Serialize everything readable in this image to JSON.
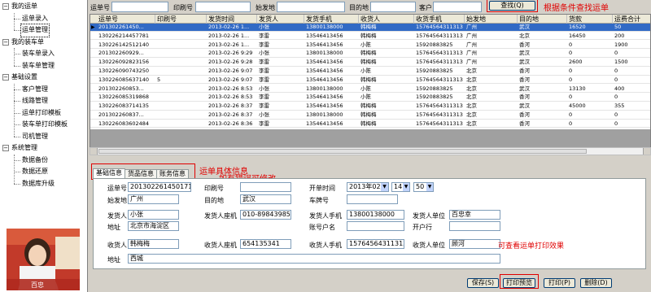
{
  "sidebar": {
    "items": [
      {
        "label": "我的运单",
        "level": 0
      },
      {
        "label": "运单录入",
        "level": 1
      },
      {
        "label": "运单管理",
        "level": 1,
        "selected": true
      },
      {
        "label": "我的装车单",
        "level": 0
      },
      {
        "label": "装车单录入",
        "level": 1
      },
      {
        "label": "装车单管理",
        "level": 1
      },
      {
        "label": "基础设置",
        "level": 0
      },
      {
        "label": "客户管理",
        "level": 1
      },
      {
        "label": "线路管理",
        "level": 1
      },
      {
        "label": "运单打印模板",
        "level": 1
      },
      {
        "label": "装车单打印模板",
        "level": 1
      },
      {
        "label": "司机管理",
        "level": 1
      },
      {
        "label": "系统管理",
        "level": 0
      },
      {
        "label": "数据备份",
        "level": 1
      },
      {
        "label": "数据还原",
        "level": 1
      },
      {
        "label": "数据库升级",
        "level": 1
      }
    ],
    "portrait_caption": "百忠"
  },
  "search": {
    "labels": [
      "运单号",
      "印刷号",
      "始发地",
      "目的地",
      "客户"
    ],
    "button": "查找(Q)",
    "annotation": "根据条件查找运单"
  },
  "grid": {
    "columns": [
      "运单号",
      "印刷号",
      "发货时间",
      "发货人",
      "发货手机",
      "收货人",
      "收货手机",
      "始发地",
      "目的地",
      "货款",
      "运费合计"
    ],
    "rows": [
      [
        "201302261450...",
        "",
        "2013-02-26 1...",
        "小张",
        "13800138000",
        "韩梅梅",
        "15764564311313",
        "广州",
        "武汉",
        "16520",
        "50"
      ],
      [
        "130226214457781",
        "",
        "2013-02-26 1...",
        "李雷",
        "13546413456",
        "韩梅梅",
        "15764564311313",
        "广州",
        "北京",
        "16450",
        "200"
      ],
      [
        "130226142512140",
        "",
        "2013-02-26 1...",
        "李雷",
        "13546413456",
        "小陈",
        "15920883825",
        "广州",
        "香河",
        "0",
        "1900"
      ],
      [
        "201302260929...",
        "",
        "2013-02-26 9:29",
        "小张",
        "13800138000",
        "韩梅梅",
        "15764564311313",
        "广州",
        "武汉",
        "0",
        "0"
      ],
      [
        "130226092823156",
        "",
        "2013-02-26 9:28",
        "李雷",
        "13546413456",
        "韩梅梅",
        "15764564311313",
        "广州",
        "武汉",
        "2600",
        "1500"
      ],
      [
        "130226090743250",
        "",
        "2013-02-26 9:07",
        "李雷",
        "13546413456",
        "小陈",
        "15920883825",
        "北京",
        "香河",
        "0",
        "0"
      ],
      [
        "130226085637140",
        "5",
        "2013-02-26 9:07",
        "李雷",
        "13546413456",
        "韩梅梅",
        "15764564311313",
        "北京",
        "香河",
        "0",
        "0"
      ],
      [
        "201302260853...",
        "",
        "2013-02-26 8:53",
        "小张",
        "13800138000",
        "小陈",
        "15920883825",
        "北京",
        "武汉",
        "13130",
        "400"
      ],
      [
        "130226085319868",
        "",
        "2013-02-26 8:53",
        "李雷",
        "13546413456",
        "小陈",
        "15920883825",
        "北京",
        "香河",
        "0",
        "0"
      ],
      [
        "130226083714135",
        "",
        "2013-02-26 8:37",
        "李雷",
        "13546413456",
        "韩梅梅",
        "15764564311313",
        "北京",
        "武汉",
        "45000",
        "355"
      ],
      [
        "201302260837...",
        "",
        "2013-02-26 8:37",
        "小张",
        "13800138000",
        "韩梅梅",
        "15764564311313",
        "北京",
        "香河",
        "0",
        "0"
      ],
      [
        "130226083602484",
        "",
        "2013-02-26 8:36",
        "李雷",
        "13546413456",
        "韩梅梅",
        "15764564311313",
        "北京",
        "香河",
        "0",
        "0"
      ]
    ]
  },
  "tabs": [
    "基础信息",
    "货品信息",
    "账务信息"
  ],
  "tab_annotation_1": "运单具体信息",
  "tab_annotation_2": "如有错误可修改",
  "form": {
    "waybill_label": "运单号",
    "waybill": "20130226145017126",
    "print_label": "印刷号",
    "print": "",
    "start_label": "开单时间",
    "start_date": "2013年02月",
    "start_hour": "14",
    "start_min": "50",
    "origin_label": "始发地",
    "origin": "广州",
    "dest_label": "目的地",
    "dest": "武汉",
    "plate_label": "车牌号",
    "plate": "",
    "sender_label": "发货人",
    "sender": "小张",
    "sender_phone_label": "发货人座机",
    "sender_phone": "010-89843985",
    "sender_mobile_label": "发货人手机",
    "sender_mobile": "13800138000",
    "sender_unit_label": "发货人单位",
    "sender_unit": "百忠幸",
    "sender_addr_label": "地址",
    "sender_addr": "北京市海淀区",
    "account_label": "账号户名",
    "account": "",
    "bank_label": "开户行",
    "bank": "",
    "receiver_label": "收货人",
    "receiver": "韩梅梅",
    "receiver_phone_label": "收货人座机",
    "receiver_phone": "654135341",
    "receiver_mobile_label": "收货人手机",
    "receiver_mobile": "15764564311313",
    "receiver_unit_label": "收货人单位",
    "receiver_unit": "顾河",
    "receiver_addr_label": "地址",
    "receiver_addr": "西城"
  },
  "print_annotation": "可查看运单打印效果",
  "buttons": {
    "save": "保存(S)",
    "preview": "打印预览",
    "print": "打印(P)",
    "delete": "删除(D)"
  },
  "colors": {
    "selection": "#316ac5",
    "annotation": "#e00000"
  }
}
